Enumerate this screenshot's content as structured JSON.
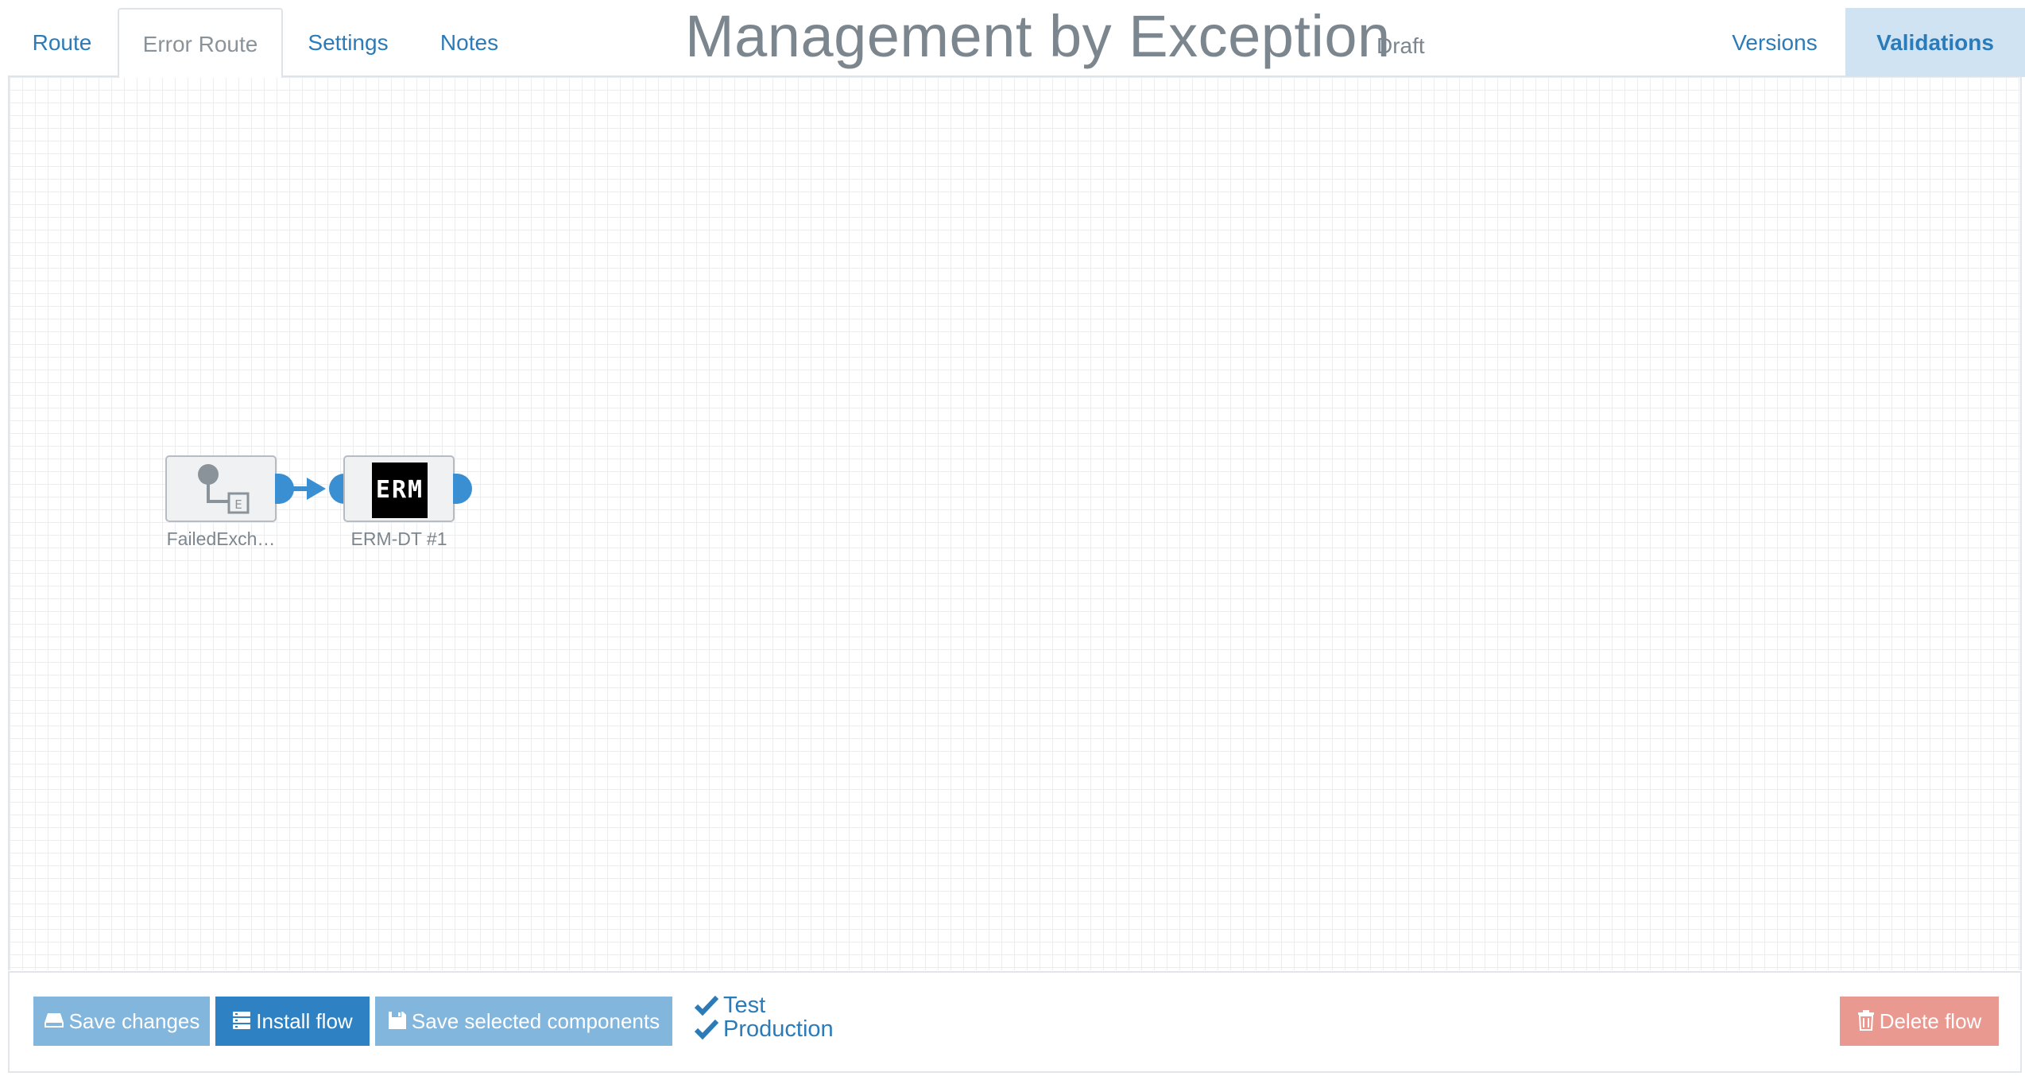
{
  "header": {
    "tabs": [
      {
        "label": "Route"
      },
      {
        "label": "Error Route",
        "active": true
      },
      {
        "label": "Settings"
      },
      {
        "label": "Notes"
      }
    ],
    "title": "Management by Exception",
    "status": "Draft",
    "right_tabs": [
      {
        "label": "Versions"
      },
      {
        "label": "Validations",
        "active": true
      }
    ]
  },
  "canvas": {
    "nodes": [
      {
        "label": "FailedExch…",
        "icon": "failed-exchange-icon"
      },
      {
        "label": "ERM-DT #1",
        "icon": "erm-logo",
        "logo_text": "ERM"
      }
    ]
  },
  "footer": {
    "save_changes": "Save changes",
    "install_flow": "Install flow",
    "save_selected": "Save selected components",
    "environments": [
      "Test",
      "Production"
    ],
    "delete_flow": "Delete flow"
  },
  "colors": {
    "accent": "#2e82c3",
    "accent_light": "#82b6dd",
    "danger": "#e99990",
    "muted_text": "#7c868e",
    "port": "#3a8fd3"
  }
}
